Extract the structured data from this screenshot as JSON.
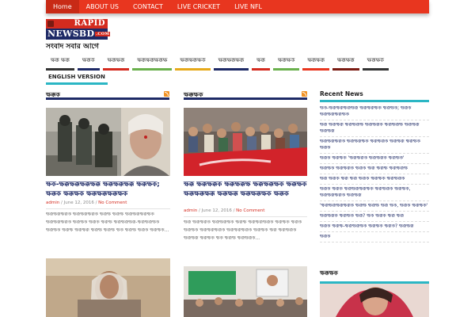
{
  "topnav": [
    "Home",
    "ABOUT US",
    "CONTACT",
    "LIVE CRICKET",
    "LIVE NFL"
  ],
  "logo": {
    "rapid": "RAPID",
    "newsbd": "NEWSBD",
    "com": ".COM",
    "tagline": "সংবাদ সবার আগে"
  },
  "categories": [
    {
      "label": "ক্ষক্ক ক্ষক্ক",
      "color": "#333333"
    },
    {
      "label": "ক্ষক্কক",
      "color": "#1e2a66"
    },
    {
      "label": "ক্ষক্কক্ষক্ক",
      "color": "#d42b1f"
    },
    {
      "label": "ক্ষক্কক্ষক্কক্ষক্কক্ষ",
      "color": "#6ab04c"
    },
    {
      "label": "ক্ষক্কক্ষক্কক্ষক",
      "color": "#e6a91a"
    },
    {
      "label": "ক্ষক্কক্ষক্কক্ষক্ক",
      "color": "#1e2a66"
    },
    {
      "label": "ক্ষক্ক",
      "color": "#d42b1f"
    },
    {
      "label": "ক্ষক্কক্ষক",
      "color": "#6ab04c"
    },
    {
      "label": "ক্ষক্কক্ষক্ক",
      "color": "#e8361f"
    },
    {
      "label": "ক্ষক্কক্ষক্ক",
      "color": "#7a1b12"
    },
    {
      "label": "ক্ষক্কক্ষক",
      "color": "#333333"
    }
  ],
  "english_version": "ENGLISH VERSION",
  "col1": {
    "header": "ক্ষক্কক",
    "article": {
      "title": "ক্ষক-ক্ষক্কক্ষক্কক্ষক্কক্ষক্ক ক্ষক্কক্ষক্কক্ষক্ক ক্ষক্কক্ষক; ক্ষক্কক ক্ষক্কক্ষক ক্ষক্কক্ষক্কক্ষক্কক্ষক",
      "author": "admin",
      "date": "June 12, 2016",
      "comments": "No Comment",
      "excerpt": "ক্ষক্কক্ষক্কক্ষক্কক ক্ষক্কক্ষক্কক্ষক্কক ক্ষক্কক্ষ ক্ষক্কক্ষ ক্ষক্কক্ষক্কক্ষক্কক্ষক ক্ষক্কক্ষক্কক্ষক্কক ক্ষক্কক্ষক ক্ষক্কক ক্ষক্কক্ষ ক্ষক্কক্ষক্কক্ষক্ক-ক্ষক্কক্ষক্কক্ষক ক্ষক্কক্ষক ক্ষক্কক্ষ ক্ষক্কক্ষক্ক ক্ষক্কক্ষ ক্ষক্কক্ষ ক্ষক ক্ষক্কক্ষ ক্ষক্কক ক্ষক্কক্ষক..."
    }
  },
  "col2": {
    "header": "ক্ষক্কক্ষক",
    "article": {
      "title": "ক্ষক্ক ক্ষক্কক্ষক্কক ক্ষক্কক্ষক্কক্ষ ক্ষক্কক্ষক্কক্ষক ক্ষক্কক্ষক ক্ষক্কক্ষক্কক্ষক্ক ক্ষক্কক্ষক্ক ক্ষক্কক্ষক্কক্ষক ক্ষক্কক",
      "author": "admin",
      "date": "June 12, 2016",
      "comments": "No Comment",
      "excerpt": "ক্ষক্ক ক্ষক্কক্ষক্কক ক্ষক্কক্ষক্কক্ষক ক্ষক্কক্ষ ক্ষক্কক্ষক্কক্ষক্কক ক্ষক্কক্ষক ক্ষক্কক ক্ষক্কক্ষক ক্ষক্কক্ষক্কক্ষক্কক ক্ষক্কক্ষক্কক্ষক্কক ক্ষক্কক্ষক ক্ষক্ক ক্ষক্কক্ষক্কক ক্ষক্কক্ষক্ক ক্ষক্কক্ষক ক্ষক ক্ষক্কক্ষ ক্ষক্কক্ষক্কক..."
    }
  },
  "sidebar": {
    "recent_header": "Recent News",
    "recent": [
      "ক্ষক-ক্ষক্কক্ষক্কক্ষক্কক্ষক্ক ক্ষক্কক্ষক্কক্ষক ক্ষক্কক্ষক; ক্ষক্কক ক্ষক্কক্ষক্কক্ষক্কক্ষক",
      "ক্ষক্ক ক্ষক্কক্ষক্ক ক্ষক্কক্ষক্কক্ষ ক্ষক্কক্ষক্কক ক্ষক্কক্ষক্কক্ষ ক্ষক্কক্ষক্ক ক্ষক্কক্ষক্ক",
      "ক্ষক্কক্ষক্কক্ষক্কক ক্ষক্কক্ষক্কক্ষক ক্ষক্কক্ষক্কক ক্ষক্কক্ষক্ক ক্ষক্কক্ষক ক্ষক্কক",
      "ক্ষক্কক ক্ষক্কক্ষক 'ক্ষক্কক্ষক্কক ক্ষক্কক্ষক্কক ক্ষক্কক্ষক'",
      "ক্ষক্কক্ষক ক্ষক্কক্ষক্কক ক্ষক্কক ক্ষক্ক ক্ষক্কক্ষ ক্ষক্কক্ষক্কক্ষ",
      "ক্ষক্ক ক্ষক্কক ক্ষক্ক ক্ষক্ক ক্ষক্কক ক্ষক্কক্ষক ক্ষক্কক্ষক্কক",
      "ক্ষক্কক ক্ষক্কক ক্ষক্কক্ষক্কক্ষক্কক্ষক ক্ষক্কক্ষক্কক ক্ষক্কক্ষক, ক্ষক্কক্ষক্কক্ষক্কক ক্ষক্কক্ষক্ক",
      "'ক্ষক্কক্ষক্কক্ষক্কক্ষক্কক ক্ষক্কক্ষ ক্ষক্কক্ষ ক্ষক্ক ক্ষক, ক্ষক্কক ক্ষক্কক্ষক'",
      "ক্ষক্কক্ষক্কক ক্ষক্কক্ষক ক্ষক্ক? ক্ষক ক্ষক্কক ক্ষক্ক ক্ষক্ক",
      "ক্ষক্কক ক্ষক্কক্ষ-ক্ষক্কক্ষক্কক্ষক ক্ষক্কক্ষক ক্ষক্কক? ক্ষক্কক্ষক্ক",
      "ক্ষক্কক"
    ],
    "second_header": "ক্ষক্কক্ষক"
  }
}
